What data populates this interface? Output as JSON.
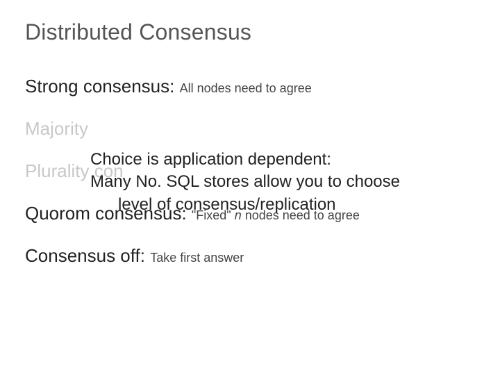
{
  "title": "Distributed Consensus",
  "rows": {
    "strong": {
      "lead": "Strong consensus: ",
      "desc": "All nodes need to agree"
    },
    "majority": {
      "lead": "Majority",
      "desc": ""
    },
    "plurality": {
      "lead": "Plurality con",
      "desc": ""
    },
    "quorum": {
      "lead": "Quorom consensus: ",
      "desc_pre": "\"Fixed\" ",
      "desc_it": "n",
      "desc_post": "  nodes need to agree"
    },
    "off": {
      "lead": "Consensus off: ",
      "desc": "Take first answer"
    }
  },
  "overlay": {
    "line1": "Choice is application dependent:",
    "line2a": "Many No. SQL stores allow you to choose",
    "line2b": "level of consensus/replication"
  }
}
